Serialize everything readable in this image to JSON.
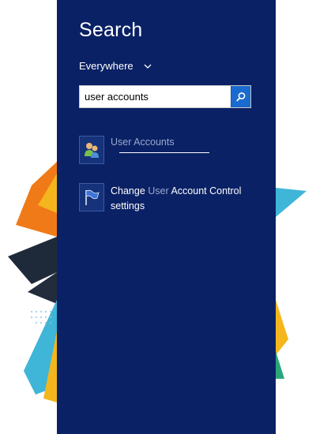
{
  "charm": {
    "title": "Search",
    "scope": {
      "label": "Everywhere",
      "chevron": "chevron-down-icon"
    },
    "search": {
      "value": "user accounts",
      "button_icon": "search-icon"
    },
    "results": [
      {
        "icon": "user-accounts-icon",
        "label": "User Accounts"
      },
      {
        "icon": "uac-flag-icon",
        "label_pre": "Change ",
        "label_hl": "User",
        "label_post": " Account Control settings"
      }
    ]
  },
  "colors": {
    "panel": "#0a2165",
    "accent_button": "#1a6bd0",
    "highlight_text": "#9aa8cf"
  }
}
